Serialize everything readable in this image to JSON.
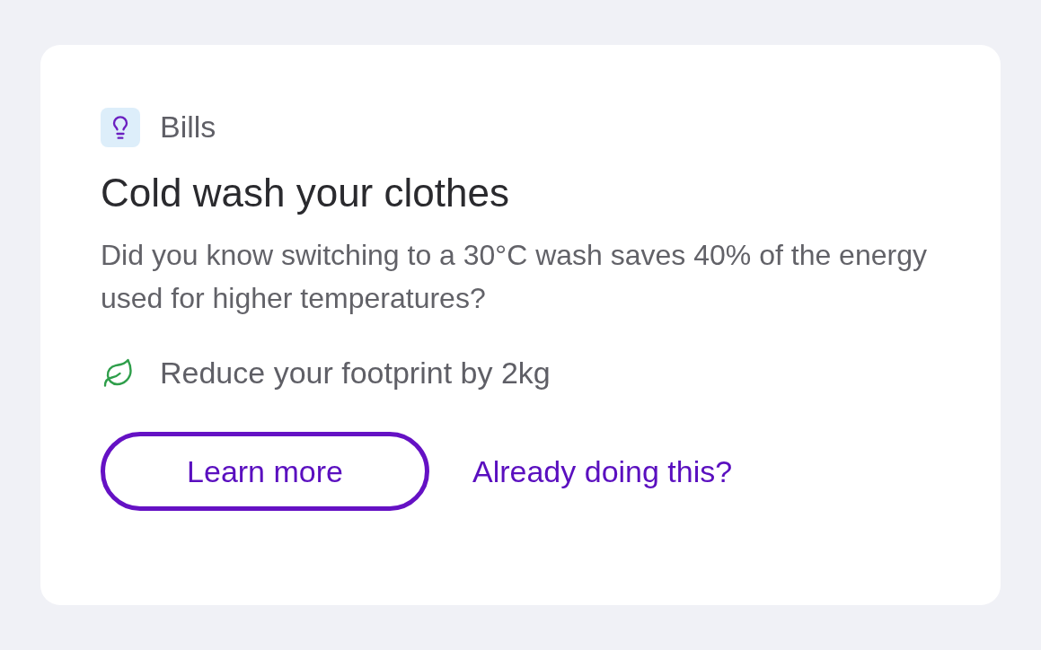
{
  "card": {
    "category": "Bills",
    "title": "Cold wash your clothes",
    "description": "Did you know switching to a 30°C wash saves 40% of the energy used for higher temperatures?",
    "impact": "Reduce your footprint by 2kg",
    "primary_button": "Learn more",
    "secondary_link": "Already doing this?"
  }
}
